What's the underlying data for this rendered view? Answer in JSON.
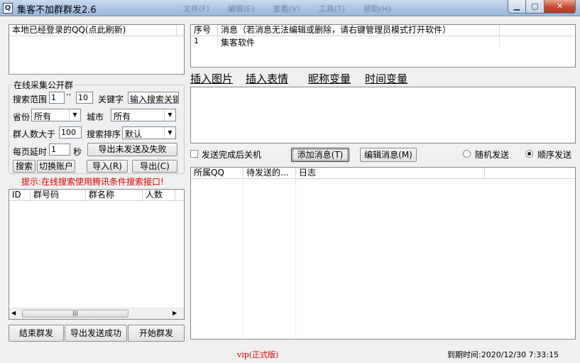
{
  "window": {
    "title": "集客不加群群发2.6",
    "menu": [
      "文件(F)",
      "编辑(E)",
      "查看(V)",
      "工具(T)",
      "帮助(H)"
    ]
  },
  "left": {
    "logged_in_header": "本地已经登录的QQ(点此刷新)",
    "group_title": "在线采集公开群",
    "search_range_label": "搜索范围",
    "range_from": "1",
    "range_sep": "--",
    "range_to": "10",
    "keyword_label": "关键字",
    "keyword_placeholder": "输入搜索关键",
    "province_label": "省份",
    "province_value": "所有",
    "city_label": "城市",
    "city_value": "所有",
    "members_label": "群人数大于",
    "members_value": "100",
    "sort_label": "搜索排序",
    "sort_value": "默认",
    "delay_label": "每页延时",
    "delay_value": "1",
    "seconds_label": "秒",
    "export_fail_button": "导出未发送及失败",
    "search_button": "搜索",
    "switch_account_button": "切换账户",
    "import_button": "导入(R)",
    "export_button": "导出(C)",
    "hint": "提示:在线搜索使用腾讯条件搜索接口!",
    "columns": [
      "ID",
      "群号码",
      "群名称",
      "人数"
    ],
    "end_button": "结束群发",
    "export_success_button": "导出发送成功",
    "start_button": "开始群发"
  },
  "right": {
    "msg_columns": [
      "序号",
      "消息（若消息无法编辑或删除，请右键管理员模式打开软件）"
    ],
    "msg_rows": [
      {
        "no": "1",
        "text": "集客软件"
      }
    ],
    "toolbar": [
      "插入图片",
      "插入表情",
      "昵称变量",
      "时间变量"
    ],
    "shutdown_label": "发送完成后关机",
    "add_msg_button": "添加消息(T)",
    "edit_msg_button": "编辑消息(M)",
    "random_label": "随机发送",
    "sequential_label": "顺序发送",
    "log_columns": [
      "所属QQ",
      "待发送的...",
      "日志"
    ]
  },
  "status": {
    "version": "vip(正式版)",
    "expiry": "到期时间:2020/12/30 7:33:15"
  }
}
